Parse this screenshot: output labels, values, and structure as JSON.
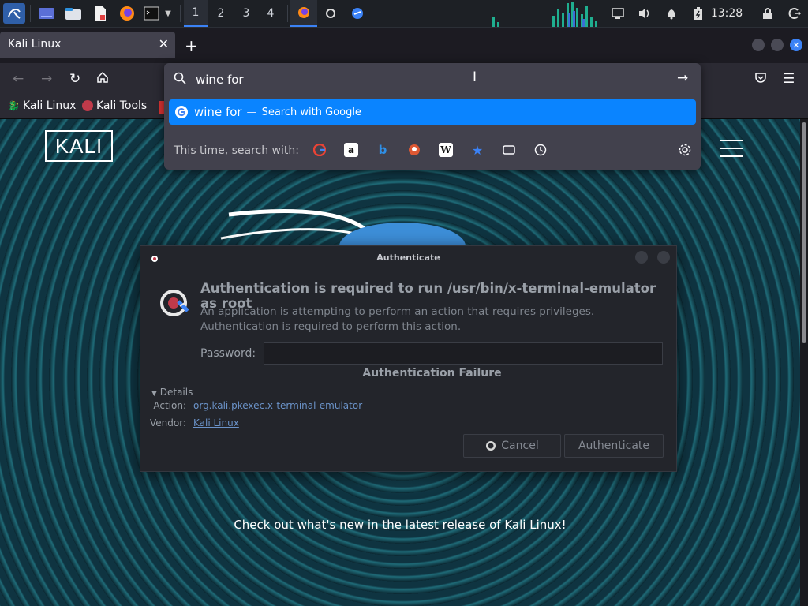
{
  "panel": {
    "workspaces": [
      "1",
      "2",
      "3",
      "4"
    ],
    "active_workspace": 0,
    "clock": "13:28"
  },
  "browser": {
    "tab_title": "Kali Linux",
    "new_tab_label": "+",
    "bookmarks": [
      "Kali Linux",
      "Kali Tools"
    ]
  },
  "urlbar": {
    "value": "wine for ",
    "suggestion_query": "wine for",
    "suggestion_separator": "—",
    "suggestion_action": "Search with Google",
    "search_with_label": "This time, search with:",
    "engines": [
      "google-icon",
      "amazon-icon",
      "bing-icon",
      "duckduckgo-icon",
      "wikipedia-icon",
      "bookmarks-icon",
      "tabs-icon",
      "history-icon"
    ]
  },
  "page": {
    "logo_text": "KALI",
    "tagline": "Check out what's new in the latest release of Kali Linux!"
  },
  "dialog": {
    "title": "Authenticate",
    "heading": "Authentication is required to run /usr/bin/x-terminal-emulator as root",
    "description": "An application is attempting to perform an action that requires privileges. Authentication is required to perform this action.",
    "password_label": "Password:",
    "password_value": "",
    "failure_text": "Authentication Failure",
    "details_label": "Details",
    "action_label": "Action:",
    "action_value": "org.kali.pkexec.x-terminal-emulator",
    "vendor_label": "Vendor:",
    "vendor_value": "Kali Linux",
    "cancel_label": "Cancel",
    "authenticate_label": "Authenticate"
  },
  "colors": {
    "accent": "#0a84ff",
    "panel_bg": "#1d2025",
    "dialog_bg": "#23252b"
  }
}
